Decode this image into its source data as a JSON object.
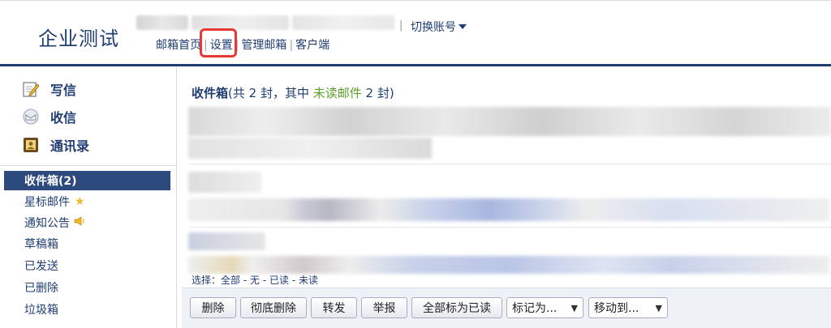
{
  "header": {
    "logo": "企业测试",
    "switch_account": "切换账号",
    "separator": "|",
    "nav": [
      {
        "label": "邮箱首页"
      },
      {
        "label": "设置"
      },
      {
        "label": "管理邮箱"
      },
      {
        "label": "客户端"
      }
    ],
    "nav_separator": "|"
  },
  "sidebar": {
    "actions": [
      {
        "label": "写信",
        "icon": "compose-icon"
      },
      {
        "label": "收信",
        "icon": "inbox-receive-icon"
      },
      {
        "label": "通讯录",
        "icon": "contacts-icon"
      }
    ],
    "folders": [
      {
        "label": "收件箱(2)",
        "active": true
      },
      {
        "label": "星标邮件",
        "icon": "star-icon"
      },
      {
        "label": "通知公告",
        "icon": "horn-icon"
      },
      {
        "label": "草稿箱"
      },
      {
        "label": "已发送"
      },
      {
        "label": "已删除"
      },
      {
        "label": "垃圾箱"
      }
    ]
  },
  "main": {
    "title_bold": "收件箱",
    "title_count": "(共 2 封，其中 ",
    "title_unread": "未读邮件",
    "title_tail": " 2 封)",
    "select_label": "选择：",
    "select_options": [
      "全部",
      "无",
      "已读",
      "未读"
    ],
    "select_sep": " - ",
    "toolbar": {
      "delete": "删除",
      "perm_delete": "彻底删除",
      "forward": "转发",
      "report": "举报",
      "mark_all_read": "全部标为已读",
      "mark_as": "标记为...",
      "move_to": "移动到..."
    }
  },
  "colors": {
    "brand": "#1f3d73",
    "active_folder": "#2d4a7e",
    "unread": "#5b9e2b",
    "highlight": "#e53935",
    "star": "#f2b927"
  }
}
